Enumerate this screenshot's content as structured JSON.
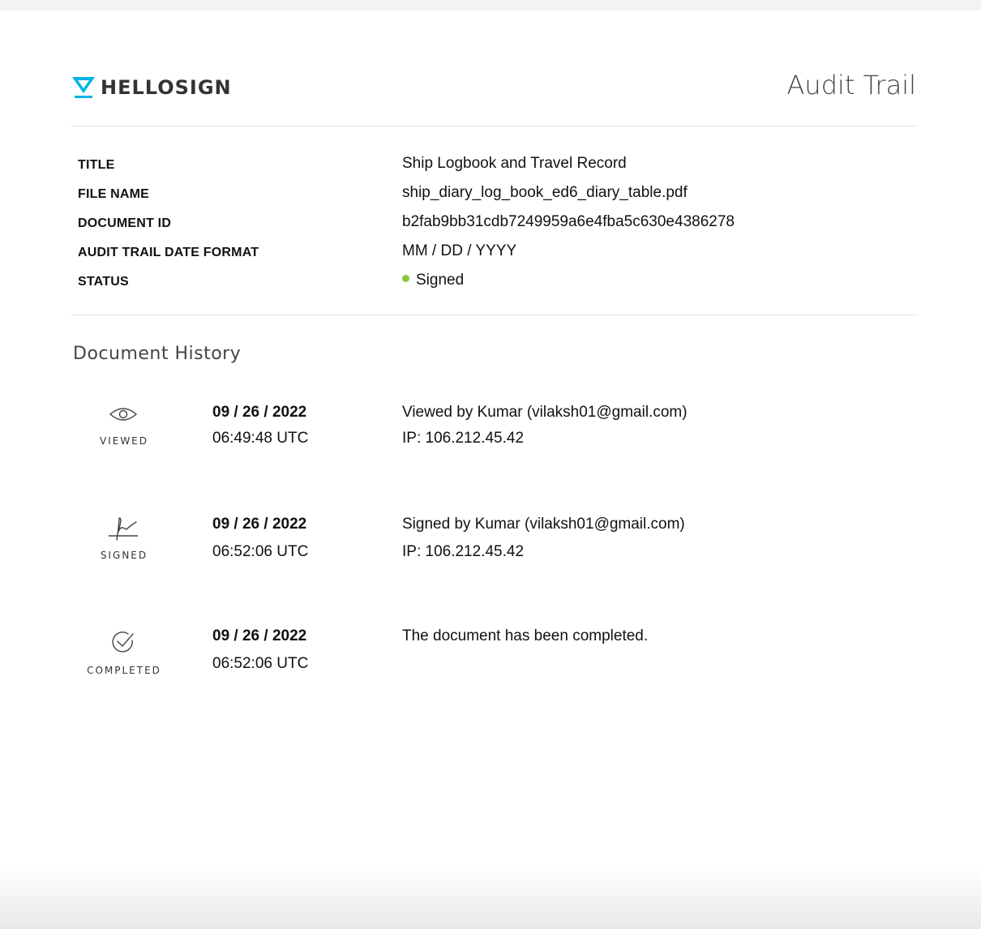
{
  "header": {
    "brand": "HELLOSIGN",
    "brand_color": "#00b3e6",
    "title": "Audit Trail"
  },
  "meta": [
    {
      "label": "TITLE",
      "value": "Ship Logbook and Travel Record"
    },
    {
      "label": "FILE NAME",
      "value": "ship_diary_log_book_ed6_diary_table.pdf"
    },
    {
      "label": "DOCUMENT ID",
      "value": "b2fab9bb31cdb7249959a6e4fba5c630e4386278"
    },
    {
      "label": "AUDIT TRAIL DATE FORMAT",
      "value": "MM / DD / YYYY"
    },
    {
      "label": "STATUS",
      "value": "Signed",
      "status_color": "#8ac53f"
    }
  ],
  "history": {
    "heading": "Document History",
    "events": [
      {
        "kind": "VIEWED",
        "icon": "eye-icon",
        "date": "09 / 26 / 2022",
        "time": "06:49:48 UTC",
        "description": "Viewed by Kumar (vilaksh01@gmail.com)",
        "ip": "IP: 106.212.45.42"
      },
      {
        "kind": "SIGNED",
        "icon": "signature-icon",
        "date": "09 / 26 / 2022",
        "time": "06:52:06 UTC",
        "description": "Signed by Kumar (vilaksh01@gmail.com)",
        "ip": "IP: 106.212.45.42"
      },
      {
        "kind": "COMPLETED",
        "icon": "check-circle-icon",
        "date": "09 / 26 / 2022",
        "time": "06:52:06 UTC",
        "description": "The document has been completed.",
        "ip": ""
      }
    ]
  }
}
